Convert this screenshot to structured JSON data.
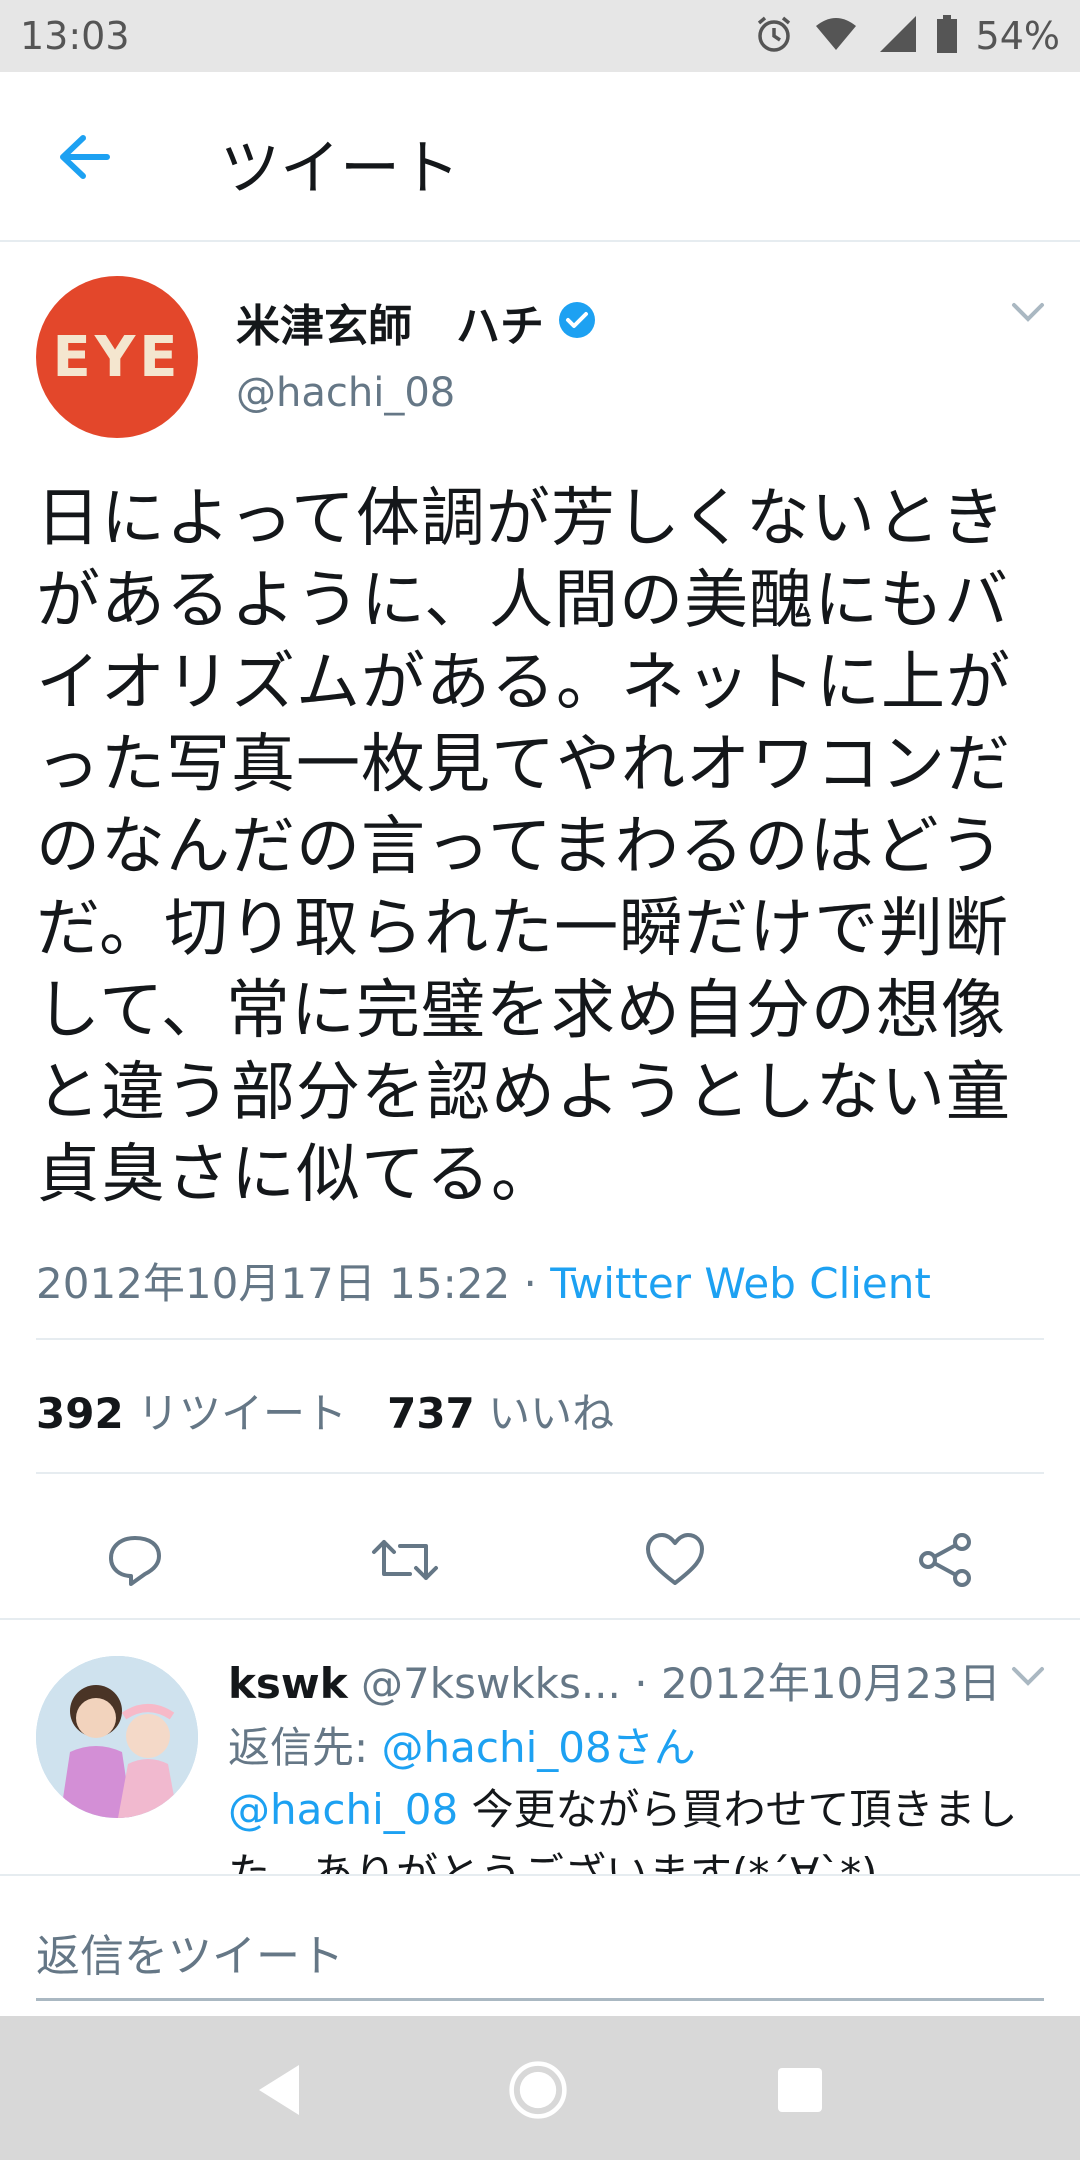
{
  "status_bar": {
    "time": "13:03",
    "battery": "54%",
    "icons": [
      "alarm-icon",
      "wifi-icon",
      "signal-icon",
      "battery-icon"
    ]
  },
  "header": {
    "title": "ツイート",
    "back_icon": "arrow-left-icon"
  },
  "tweet": {
    "avatar_text": "EYE",
    "author_name": "米津玄師　ハチ",
    "handle": "@hachi_08",
    "verified_icon": "verified-badge-icon",
    "text_lines": [
      "日によって体調が芳しくないとき",
      "があるように、人間の美醜にもバ",
      "イオリズムがある。ネットに上が",
      "った写真一枚見てやれオワコンだ",
      "のなんだの言ってまわるのはどう",
      "だ。切り取られた一瞬だけで判断",
      "して、常に完璧を求め自分の想像",
      "と違う部分を認めようとしない童",
      "貞臭さに似てる。"
    ],
    "timestamp": "2012年10月17日 15:22",
    "separator": " · ",
    "client": "Twitter Web Client",
    "retweet_count": "392",
    "retweet_label": " リツイート",
    "like_count": "737",
    "like_label": " いいね",
    "actions": [
      "reply-icon",
      "retweet-icon",
      "like-icon",
      "share-icon"
    ]
  },
  "reply": {
    "name": "kswk",
    "handle": "@7kswkks...",
    "date": " · 2012年10月23日",
    "reply_to_label": "返信先: ",
    "reply_to_handle": "@hachi_08さん",
    "mention": "@hachi_08",
    "body_line1": " 今更ながら買わせて頂きまし",
    "body_line2": "た。ありがとうございます(*´∀`*)"
  },
  "compose": {
    "placeholder": "返信をツイート"
  },
  "colors": {
    "accent": "#1da1f2",
    "secondary_text": "#657786",
    "avatar_bg": "#e3472b"
  }
}
